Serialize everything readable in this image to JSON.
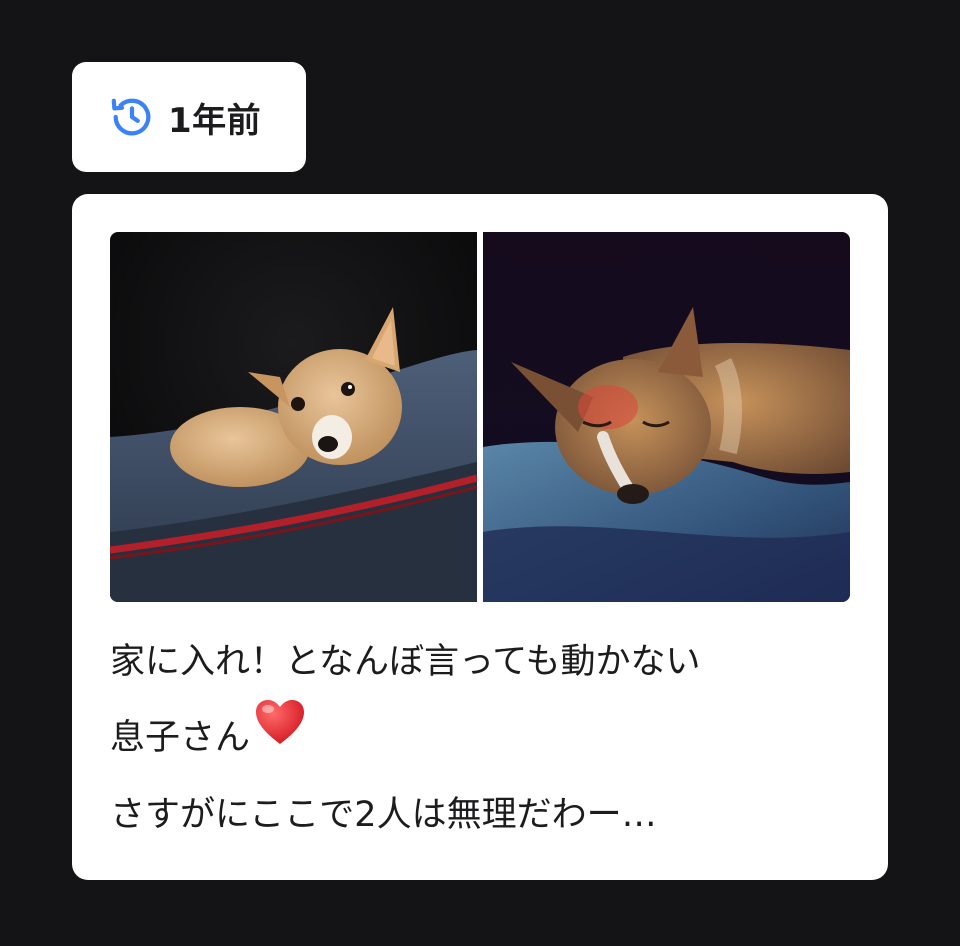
{
  "badge": {
    "icon": "history-clock-icon",
    "label": "1年前",
    "icon_color": "#3b82f6"
  },
  "post": {
    "photos": [
      {
        "name": "corgi-on-sleeping-bag-photo",
        "description_icon": "dog-photo"
      },
      {
        "name": "corgi-sleeping-dark-photo",
        "description_icon": "dog-photo"
      }
    ],
    "caption_line1": "家に入れ！となんぼ言っても動かない",
    "caption_line2": "息子さん",
    "caption_emoji": "heart-icon",
    "caption_line3": "さすがにここで2人は無理だわー…"
  },
  "colors": {
    "background": "#141416",
    "card": "#ffffff",
    "heart": "#e0282e"
  }
}
